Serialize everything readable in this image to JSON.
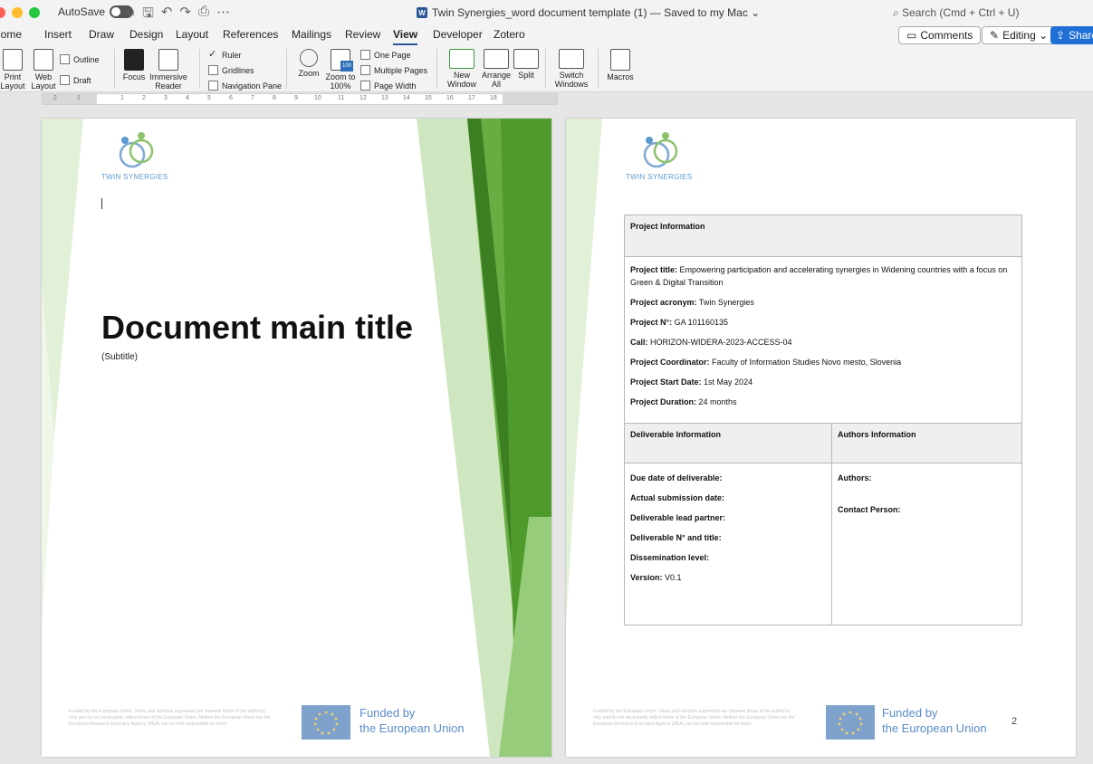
{
  "titlebar": {
    "autosave_label": "AutoSave",
    "document_title": "Twin Synergies_word document template (1) — Saved to my Mac ⌄",
    "search_placeholder": "Search (Cmd + Ctrl + U)"
  },
  "tabs": [
    "Home",
    "Insert",
    "Draw",
    "Design",
    "Layout",
    "References",
    "Mailings",
    "Review",
    "View",
    "Developer",
    "Zotero"
  ],
  "active_tab": "View",
  "actions": {
    "comments": "Comments",
    "editing": "Editing ⌄",
    "share": "Share"
  },
  "ribbon": {
    "print_layout": "Print Layout",
    "web_layout": "Web Layout",
    "outline": "Outline",
    "draft": "Draft",
    "focus": "Focus",
    "immersive_reader": "Immersive Reader",
    "ruler": "Ruler",
    "gridlines": "Gridlines",
    "navigation_pane": "Navigation Pane",
    "zoom": "Zoom",
    "zoom_100": "Zoom to 100%",
    "one_page": "One Page",
    "multiple_pages": "Multiple Pages",
    "page_width": "Page Width",
    "new_window": "New Window",
    "arrange_all": "Arrange All",
    "split": "Split",
    "switch_windows": "Switch Windows",
    "macros": "Macros",
    "ruler_checked": true
  },
  "ruler_marks": [
    "2",
    "1",
    "1",
    "2",
    "3",
    "4",
    "5",
    "6",
    "7",
    "8",
    "9",
    "10",
    "11",
    "12",
    "13",
    "14",
    "15",
    "16",
    "17",
    "18"
  ],
  "colors": {
    "accent": "#2b5797",
    "green_dark": "#4e9a2c",
    "green_light": "#b9dca6",
    "eu_blue": "#7fa2cc"
  },
  "page1": {
    "logo_text": "TWIN SYNERGIES",
    "main_title": "Document main title",
    "subtitle": "(Subtitle)",
    "footer_note": "Funded by the European Union. Views and opinions expressed are however those of the author(s) only and do not necessarily reflect those of the European Union. Neither the European Union nor the European Research Executive Agency (REA) can be held responsible for them.",
    "eu_line1": "Funded by",
    "eu_line2": "the European Union"
  },
  "page2": {
    "logo_text": "TWIN SYNERGIES",
    "project_info_header": "Project Information",
    "project_fields": [
      {
        "label": "Project title:",
        "value": "Empowering participation and accelerating synergies in Widening countries with a focus on Green & Digital Transition"
      },
      {
        "label": "Project acronym:",
        "value": "Twin Synergies"
      },
      {
        "label": "Project N°:",
        "value": "GA 101160135"
      },
      {
        "label": "Call:",
        "value": "HORIZON-WIDERA-2023-ACCESS-04"
      },
      {
        "label": "Project Coordinator:",
        "value": "Faculty of Information Studies Novo mesto, Slovenia"
      },
      {
        "label": "Project Start Date:",
        "value": "1st May 2024"
      },
      {
        "label": "Project Duration:",
        "value": "24 months"
      }
    ],
    "deliverable_header": "Deliverable  Information",
    "authors_header": "Authors Information",
    "deliverable_fields": [
      {
        "label": "Due date of deliverable:",
        "value": ""
      },
      {
        "label": "Actual submission date:",
        "value": ""
      },
      {
        "label": "Deliverable lead partner:",
        "value": ""
      },
      {
        "label": "Deliverable N° and title:",
        "value": ""
      },
      {
        "label": "Dissemination level:",
        "value": ""
      },
      {
        "label": "Version:",
        "value": "V0.1"
      }
    ],
    "authors_label": "Authors:",
    "contact_label": "Contact Person:",
    "footer_note": "Funded by the European Union. Views and opinions expressed are however those of the author(s) only and do not necessarily reflect those of the European Union. Neither the European Union nor the European Research Executive Agency (REA) can be held responsible for them.",
    "eu_line1": "Funded by",
    "eu_line2": "the European Union",
    "page_number": "2"
  }
}
